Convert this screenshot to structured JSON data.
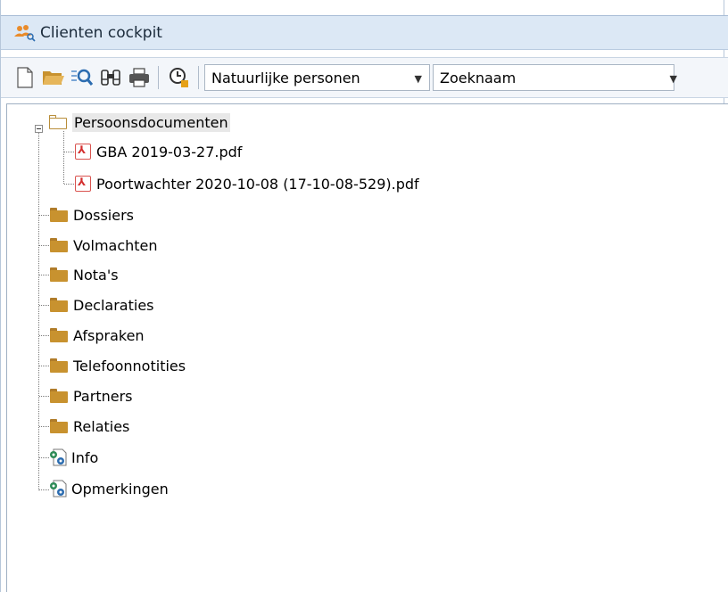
{
  "window": {
    "title": "Clienten cockpit"
  },
  "toolbar": {
    "buttons": [
      {
        "name": "new-document-icon"
      },
      {
        "name": "open-folder-icon"
      },
      {
        "name": "search-list-icon"
      },
      {
        "name": "binoculars-icon"
      },
      {
        "name": "print-icon"
      },
      {
        "name": "history-clock-icon"
      }
    ],
    "type_combo": {
      "value": "Natuurlijke personen"
    },
    "search_combo": {
      "value": "Zoeknaam"
    }
  },
  "tree": {
    "root": {
      "label": "Persoonsdocumenten",
      "expanded": true,
      "selected": true
    },
    "files": [
      {
        "label": "GBA 2019-03-27.pdf"
      },
      {
        "label": "Poortwachter 2020-10-08 (17-10-08-529).pdf"
      }
    ],
    "folders": [
      {
        "label": "Dossiers"
      },
      {
        "label": "Volmachten"
      },
      {
        "label": "Nota's"
      },
      {
        "label": "Declaraties"
      },
      {
        "label": "Afspraken"
      },
      {
        "label": "Telefoonnotities"
      },
      {
        "label": "Partners"
      },
      {
        "label": "Relaties"
      }
    ],
    "items": [
      {
        "label": "Info"
      },
      {
        "label": "Opmerkingen"
      }
    ]
  },
  "colors": {
    "titlebar_bg": "#dce8f5",
    "folder": "#c8922f",
    "pdf_red": "#d32f2f",
    "config_green": "#2e8b57",
    "config_blue": "#2b6cb0"
  }
}
